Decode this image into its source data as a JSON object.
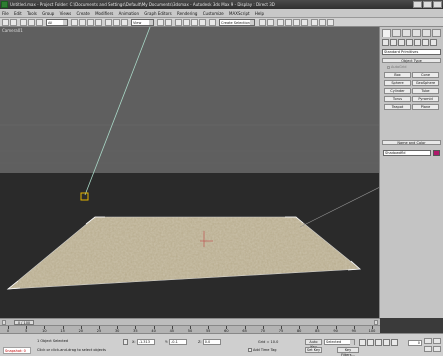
{
  "titlebar": {
    "text": "Untitled.max - Project Folder: C:\\Documents and Settings\\Default\\My Documents\\3dsmax - Autodesk 3ds Max 9 - Display : Direct 3D",
    "buttons": [
      "minimize",
      "maximize",
      "close"
    ]
  },
  "menubar": {
    "items": [
      "File",
      "Edit",
      "Tools",
      "Group",
      "Views",
      "Create",
      "Modifiers",
      "Animation",
      "Graph Editors",
      "Rendering",
      "Customize",
      "MAXScript",
      "Help"
    ]
  },
  "toolbar": {
    "selection_filter": "All",
    "refcoord": "View",
    "named_selection": "Create Selection Set"
  },
  "viewport": {
    "label": "Camera01"
  },
  "command_panel": {
    "category_dropdown": "Standard Primitives",
    "object_type_header": "Object Type",
    "autogrid_label": "AutoGrid",
    "buttons": [
      "Box",
      "Cone",
      "Sphere",
      "GeoSphere",
      "Cylinder",
      "Tube",
      "Torus",
      "Pyramid",
      "Teapot",
      "Plane"
    ],
    "name_color_header": "Name and Color",
    "object_name": "Shadowdfld",
    "object_color": "#b0186b"
  },
  "timeline": {
    "slider_label": "0 / 100",
    "ticks": [
      "0",
      "5",
      "10",
      "15",
      "20",
      "25",
      "30",
      "35",
      "40",
      "45",
      "50",
      "55",
      "60",
      "65",
      "70",
      "75",
      "80",
      "85",
      "90",
      "95",
      "100"
    ]
  },
  "status": {
    "selected_box": "Snapshot: 0",
    "objects_selected": "1 Object Selected",
    "prompt": "Click or click-and-drag to select objects",
    "x_label": "X:",
    "x_value": "-1.313",
    "y_label": "Y:",
    "y_value": "-0.1",
    "z_label": "Z:",
    "z_value": "0.0",
    "grid_text": "Grid = 10.0",
    "add_time_tag": "Add Time Tag",
    "auto_key": "Auto Key",
    "set_key": "Set Key",
    "key_mode": "Selected",
    "key_filters": "Key Filters...",
    "frame": "0"
  }
}
